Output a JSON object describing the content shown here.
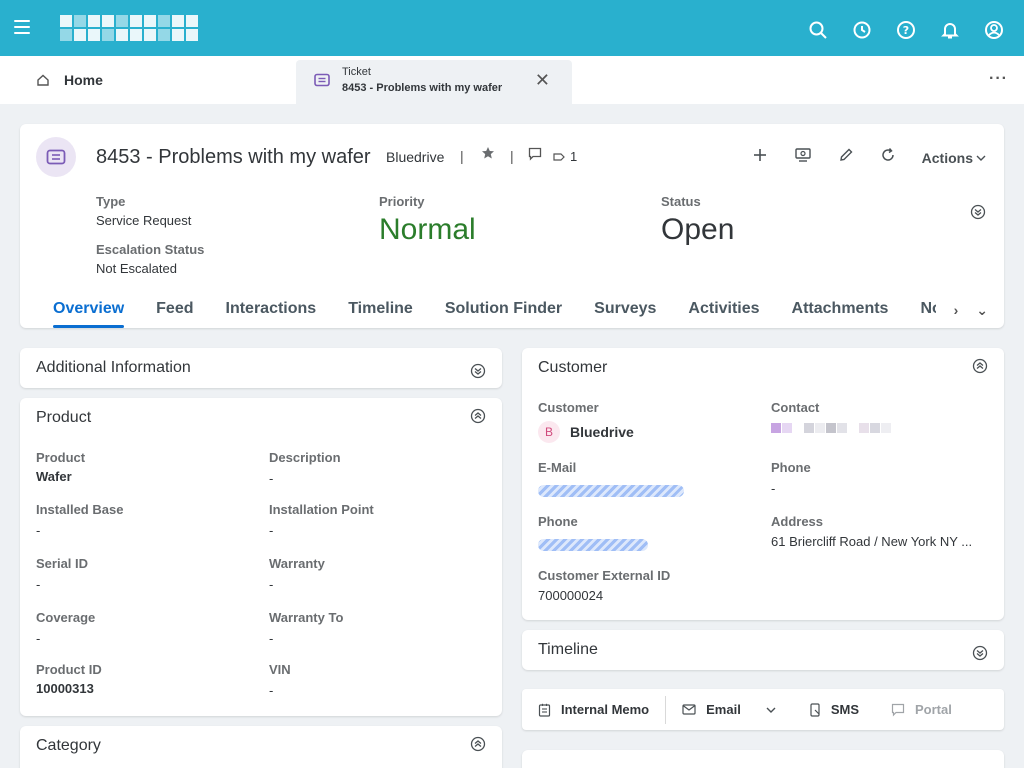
{
  "colors": {
    "shell": "#29b0ce",
    "accent": "#0a6ed1",
    "priority_normal": "#2b7d2b",
    "status_open": "#32363a"
  },
  "shell": {
    "icons": [
      "menu-icon",
      "search-icon",
      "history-icon",
      "help-icon",
      "notifications-icon",
      "user-icon"
    ]
  },
  "tabs": {
    "home_label": "Home",
    "ticket_kind": "Ticket",
    "ticket_title": "8453 - Problems with my wafer",
    "close": "✕",
    "more": "···"
  },
  "header": {
    "title": "8453 - Problems with my wafer",
    "org": "Bluedrive",
    "separator": "|",
    "comment_count": "1",
    "actions_label": "Actions",
    "fields": {
      "type_label": "Type",
      "type_value": "Service Request",
      "escalation_label": "Escalation Status",
      "escalation_value": "Not Escalated",
      "priority_label": "Priority",
      "priority_value": "Normal",
      "status_label": "Status",
      "status_value": "Open"
    },
    "nav": [
      "Overview",
      "Feed",
      "Interactions",
      "Timeline",
      "Solution Finder",
      "Surveys",
      "Activities",
      "Attachments",
      "Notes"
    ],
    "nav_prev": "›",
    "nav_more": "⌄"
  },
  "additional": {
    "title": "Additional Information"
  },
  "product": {
    "title": "Product",
    "fields": [
      {
        "label": "Product",
        "value": "Wafer",
        "bold": true
      },
      {
        "label": "Description",
        "value": "-"
      },
      {
        "label": "Installed Base",
        "value": "-"
      },
      {
        "label": "Installation Point",
        "value": "-"
      },
      {
        "label": "Serial ID",
        "value": "-"
      },
      {
        "label": "Warranty",
        "value": "-"
      },
      {
        "label": "Coverage",
        "value": "-"
      },
      {
        "label": "Warranty To",
        "value": "-"
      },
      {
        "label": "Product ID",
        "value": "10000313",
        "bold": true
      },
      {
        "label": "VIN",
        "value": "-"
      }
    ]
  },
  "category": {
    "title": "Category"
  },
  "customer": {
    "title": "Customer",
    "customer_label": "Customer",
    "customer_initial": "B",
    "customer_name": "Bluedrive",
    "contact_label": "Contact",
    "email_label": "E-Mail",
    "phone_label": "Phone",
    "phone_value": "-",
    "phone2_label": "Phone",
    "address_label": "Address",
    "address_value": "61 Briercliff Road / New York NY ...",
    "external_id_label": "Customer External ID",
    "external_id_value": "700000024"
  },
  "timeline": {
    "title": "Timeline"
  },
  "comm": {
    "memo": "Internal Memo",
    "email": "Email",
    "sms": "SMS",
    "portal": "Portal"
  }
}
